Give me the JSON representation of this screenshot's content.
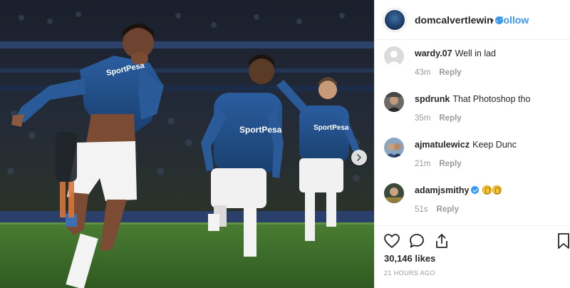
{
  "post": {
    "photo": {
      "shirt_sponsor": "SportPesa",
      "alt": ""
    },
    "header": {
      "username": "domcalvertlewin",
      "separator": "•",
      "follow_label": "Follow"
    },
    "comments": [
      {
        "user": "wardy.07",
        "text": "Well in lad",
        "time": "43m",
        "reply": "Reply",
        "emoji_count": 0
      },
      {
        "user": "spdrunk",
        "text": "That Photoshop tho",
        "time": "35m",
        "reply": "Reply",
        "emoji_count": 0
      },
      {
        "user": "ajmatulewicz",
        "text": "Keep Dunc",
        "time": "21m",
        "reply": "Reply",
        "emoji_count": 0
      },
      {
        "user": "adamjsmithy",
        "text": "",
        "time": "51s",
        "reply": "Reply",
        "verified": true,
        "emoji_count": 2
      }
    ],
    "likes": "30,146 likes",
    "time_ago": "21 HOURS AGO"
  },
  "colors": {
    "accent_blue": "#3897f0",
    "kit_blue": "#1f4e8c",
    "pitch_green": "#3c6b2b",
    "muted_text": "#999999"
  }
}
